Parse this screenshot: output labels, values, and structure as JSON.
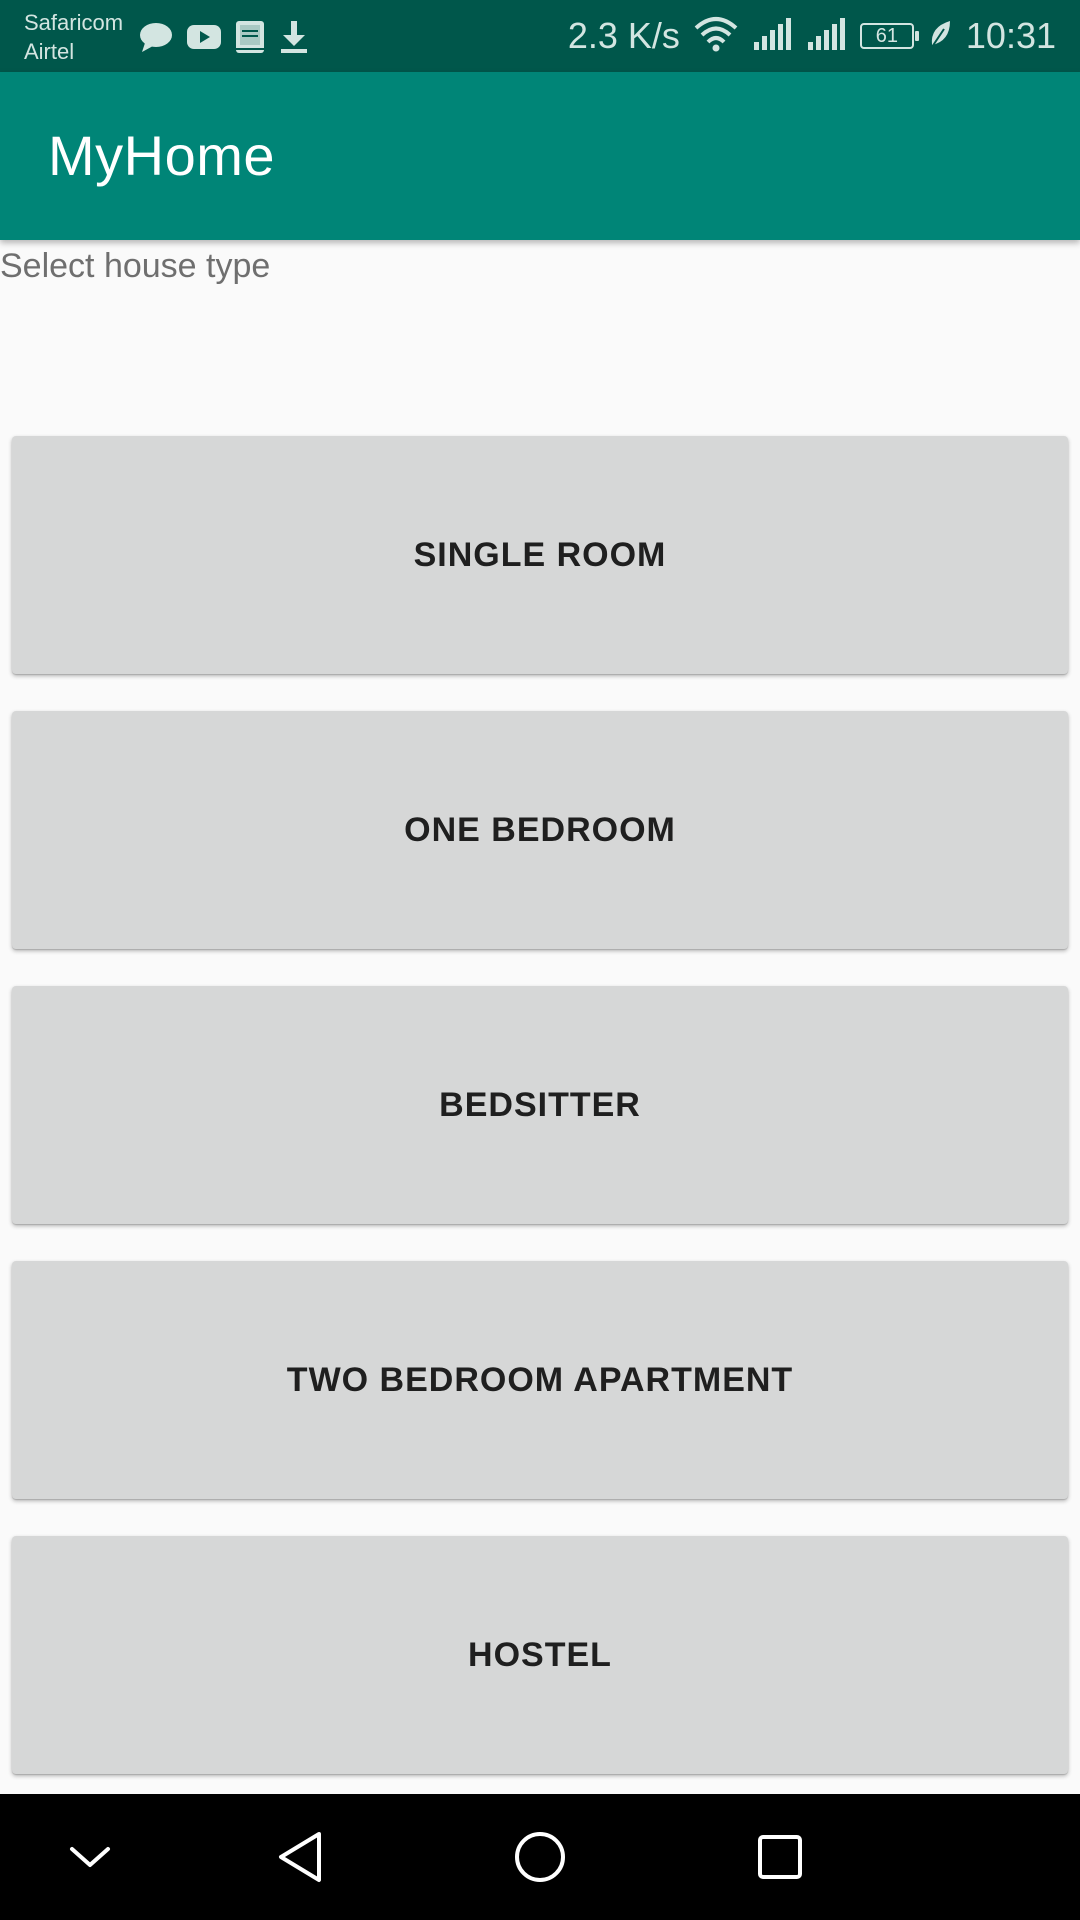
{
  "status_bar": {
    "carrier_primary": "Safaricom",
    "carrier_secondary": "Airtel",
    "network_speed": "2.3 K/s",
    "battery_level": "61",
    "time": "10:31",
    "notification_icons": [
      "chat-bubble-icon",
      "youtube-icon",
      "holy-bible-icon",
      "download-icon"
    ],
    "system_icons": [
      "wifi-icon",
      "signal-1-icon",
      "signal-2-icon",
      "battery-icon",
      "leaf-icon"
    ]
  },
  "app_bar": {
    "title": "MyHome",
    "color": "#008577",
    "status_color": "#00574b"
  },
  "main": {
    "prompt": "Select house type",
    "house_types": [
      "SINGLE ROOM",
      "ONE BEDROOM",
      "BEDSITTER",
      "TWO BEDROOM APARTMENT",
      "HOSTEL"
    ]
  },
  "nav_bar": {
    "icons": [
      "collapse-chevron-icon",
      "back-icon",
      "home-icon",
      "recents-icon"
    ]
  }
}
